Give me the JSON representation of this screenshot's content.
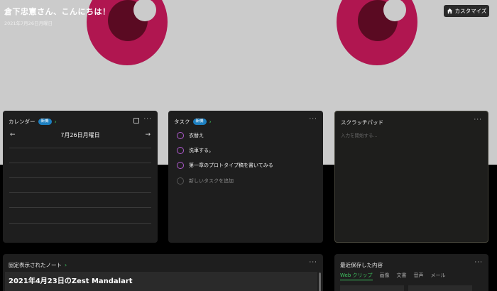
{
  "header": {
    "greeting": "倉下忠憲さん、こんにちは！",
    "date": "2021年7月26日月曜日",
    "customize_label": "カスタマイズ"
  },
  "calendar": {
    "title": "カレンダー",
    "badge": "新機",
    "date": "7月26日月曜日"
  },
  "tasks": {
    "title": "タスク",
    "badge": "新機",
    "items": [
      {
        "label": "衣替え"
      },
      {
        "label": "洗車する。"
      },
      {
        "label": "第一章のプロトタイプ稿を書いてみる"
      }
    ],
    "add_label": "新しいタスクを追加"
  },
  "scratchpad": {
    "title": "スクラッチパッド",
    "placeholder": "入力を開始する..."
  },
  "pinned_note": {
    "title": "固定表示されたノート",
    "note_title": "2021年4月23日のZest Mandalart"
  },
  "recent": {
    "title": "最近保存した内容",
    "tabs": [
      "Web クリップ",
      "画像",
      "文書",
      "音声",
      "メール"
    ],
    "active_tab": 0
  },
  "menu_label": "···",
  "colors": {
    "accent_green": "#3ec35f",
    "badge_blue": "#1d7fc0",
    "task_circle": "#b05ad0",
    "eye": "#b01650"
  }
}
